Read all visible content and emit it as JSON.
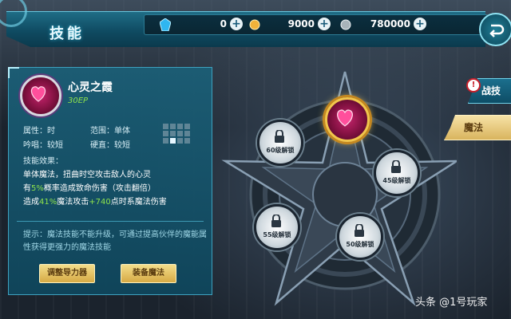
{
  "header": {
    "title": "技能",
    "currencies": [
      {
        "icon": "blue-crystal-icon",
        "value": "0"
      },
      {
        "icon": "gold-coin-icon",
        "value": "9000"
      },
      {
        "icon": "silver-coin-icon",
        "value": "780000"
      }
    ],
    "back_icon": "back-arrow-icon"
  },
  "skill": {
    "name": "心灵之霞",
    "ep": "30EP",
    "attribute_label": "属性：时",
    "range_label": "范围：单体",
    "chant_label": "吟唱：较短",
    "stiff_label": "硬直：较短",
    "range_grid_active": [
      [
        3,
        1
      ]
    ],
    "effect_title": "技能效果：",
    "effect_line1": "单体魔法，扭曲时空攻击敌人的心灵",
    "effect_line2_pre": "有",
    "effect_line2_pct": "5%",
    "effect_line2_post": "概率造成致命伤害（攻击翻倍）",
    "effect_line3_pre": "造成",
    "effect_line3_pct": "41%",
    "effect_line3_mid": "魔法攻击",
    "effect_line3_add": "+740",
    "effect_line3_post": "点时系魔法伤害",
    "tip": "提示：魔法技能不能升级，可通过提高伙伴的魔能属性获得更强力的魔法技能"
  },
  "buttons": {
    "adjust": "调整导力器",
    "equip": "装备魔法"
  },
  "slots": [
    {
      "label": "60级解锁"
    },
    {
      "label": "45级解锁"
    },
    {
      "label": "55级解锁"
    },
    {
      "label": "50级解锁"
    }
  ],
  "tabs": {
    "war": "战技",
    "magic": "魔法",
    "war_badge": "!"
  },
  "watermark": "头条 @1号玩家",
  "colors": {
    "accent": "#1f6d86",
    "highlight_green": "#8ee24c",
    "gold": "#d9b45e"
  }
}
